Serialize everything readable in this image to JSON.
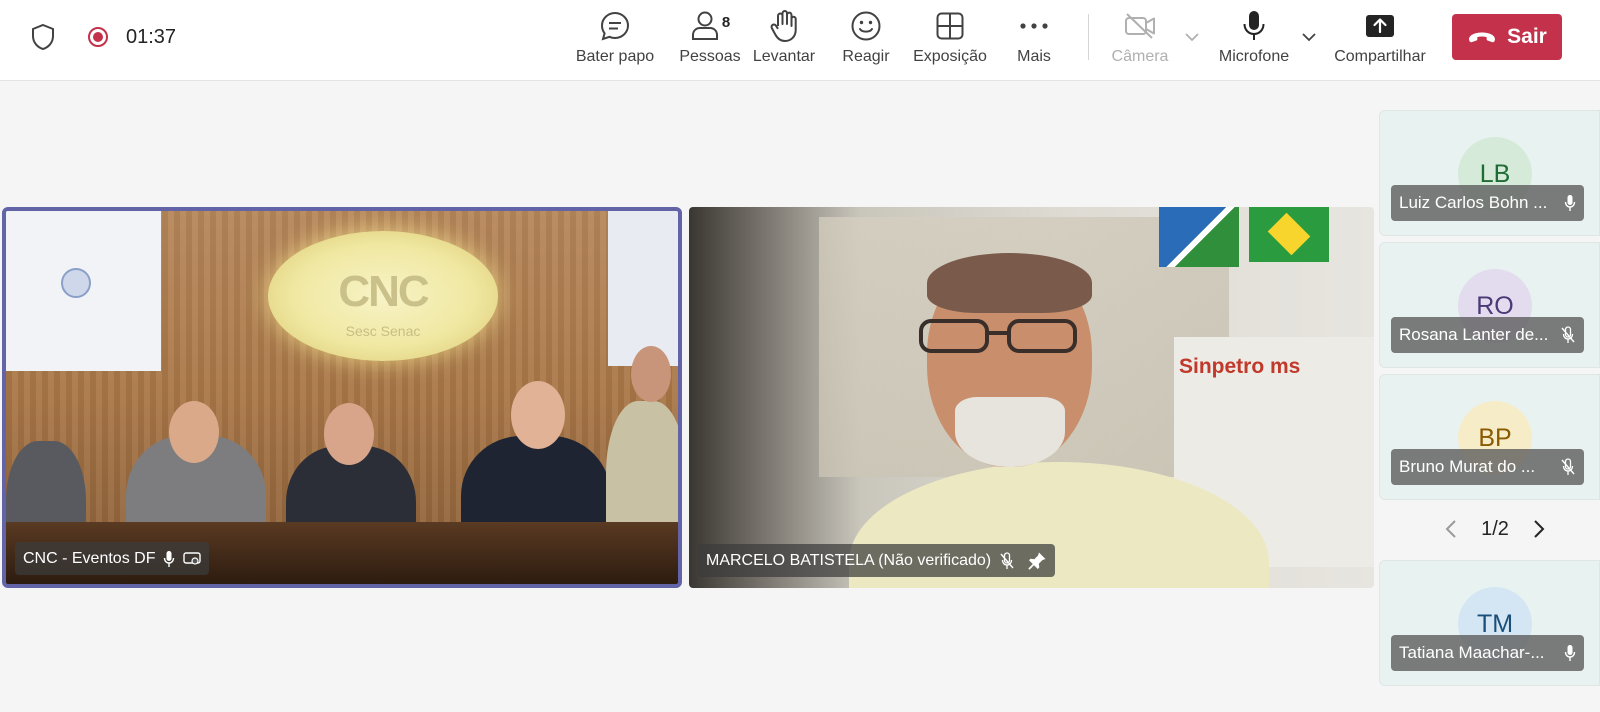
{
  "header": {
    "timer": "01:37",
    "buttons": {
      "chat": "Bater papo",
      "people": "Pessoas",
      "people_count": "8",
      "raise": "Levantar",
      "react": "Reagir",
      "view": "Exposição",
      "more": "Mais",
      "camera": "Câmera",
      "mic": "Microfone",
      "share": "Compartilhar"
    },
    "leave_label": "Sair"
  },
  "stage": {
    "tiles": [
      {
        "name": "CNC - Eventos DF",
        "logo_text": "CNC",
        "screen_text": "Sesc Senac"
      },
      {
        "name": "MARCELO BATISTELA (Não verificado)",
        "sign_text": "Sinpetro ms"
      }
    ]
  },
  "roster": {
    "participants": [
      {
        "initials": "LB",
        "name": "Luiz Carlos Bohn ...",
        "bg": "#d5ead9",
        "fg": "#1e6b33"
      },
      {
        "initials": "RO",
        "name": "Rosana Lanter de...",
        "bg": "#e3dcee",
        "fg": "#4b3a78"
      },
      {
        "initials": "BP",
        "name": "Bruno Murat do ...",
        "bg": "#f7ecc8",
        "fg": "#8a5a00"
      },
      {
        "initials": "TM",
        "name": "Tatiana Maachar-...",
        "bg": "#d4e6f3",
        "fg": "#1b4f7a"
      }
    ],
    "pager": "1/2"
  },
  "colors": {
    "accent": "#6264a7",
    "leave": "#c4314b",
    "recording": "#c4314b"
  }
}
